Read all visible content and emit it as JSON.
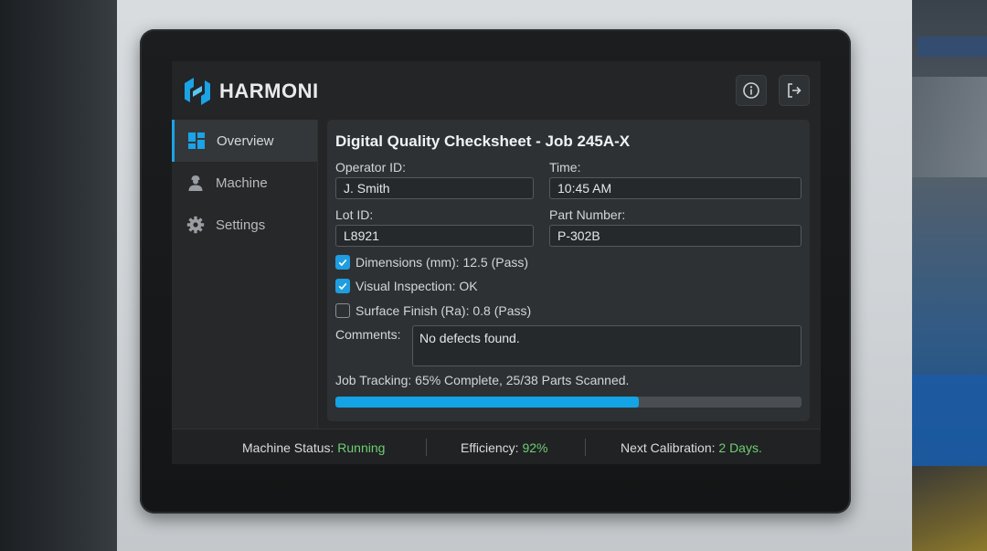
{
  "brand": {
    "name": "HARMONI",
    "accent": "#1aa3e6"
  },
  "header": {
    "info_icon": "info-circle-icon",
    "logout_icon": "logout-icon"
  },
  "sidebar": {
    "items": [
      {
        "label": "Overview",
        "icon": "dashboard-grid-icon",
        "active": true
      },
      {
        "label": "Machine",
        "icon": "operator-person-icon",
        "active": false
      },
      {
        "label": "Settings",
        "icon": "gear-icon",
        "active": false
      }
    ]
  },
  "form": {
    "title": "Digital Quality Checksheet - Job 245A-X",
    "operator_label": "Operator ID:",
    "operator_value": "J. Smith",
    "time_label": "Time:",
    "time_value": "10:45 AM",
    "lot_label": "Lot ID:",
    "lot_value": "L8921",
    "part_label": "Part Number:",
    "part_value": "P-302B",
    "checks": [
      {
        "label": "Dimensions (mm): 12.5 (Pass)",
        "checked": true
      },
      {
        "label": "Visual Inspection: OK",
        "checked": true
      },
      {
        "label": "Surface Finish (Ra): 0.8 (Pass)",
        "checked": false
      }
    ],
    "comments_label": "Comments:",
    "comments_value": "No defects found.",
    "tracking_text": "Job Tracking: 65% Complete, 25/38 Parts Scanned.",
    "progress_percent": 65
  },
  "status_bar": {
    "machine_label": "Machine Status: ",
    "machine_value": "Running",
    "efficiency_label": "Efficiency: ",
    "efficiency_value": "92%",
    "calibration_label": "Next Calibration: ",
    "calibration_value": "2 Days.",
    "value_color": "#6fce72"
  }
}
